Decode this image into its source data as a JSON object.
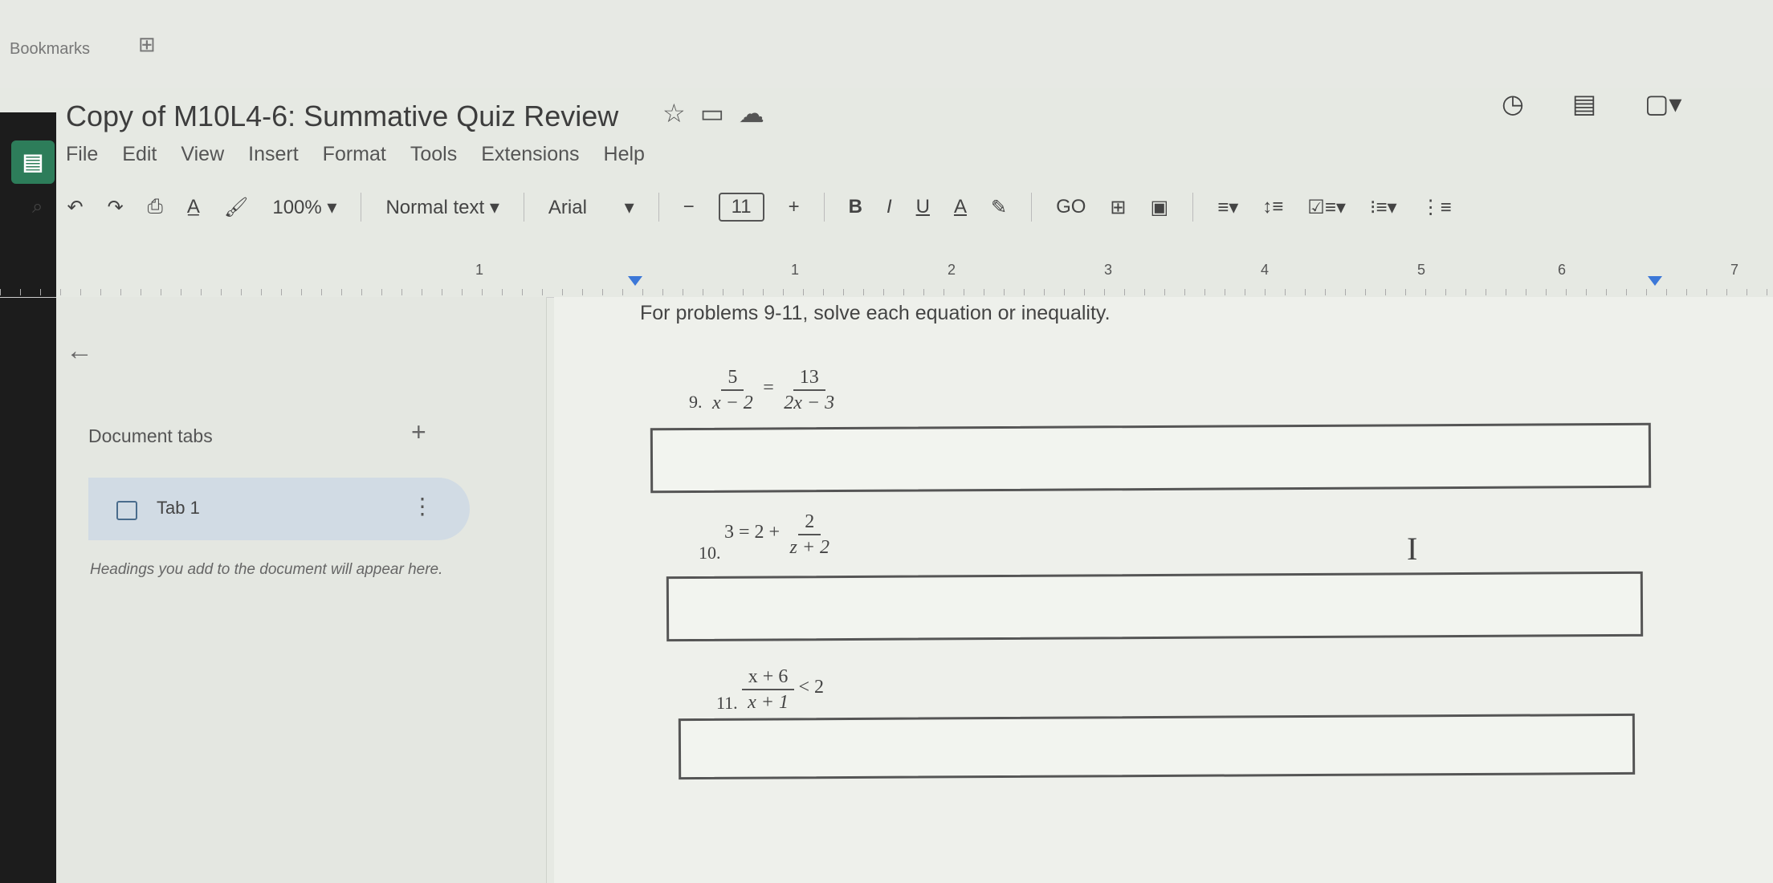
{
  "bookmarks": {
    "label": "Bookmarks"
  },
  "document": {
    "title": "Copy of M10L4-6: Summative Quiz Review"
  },
  "menu": [
    "File",
    "Edit",
    "View",
    "Insert",
    "Format",
    "Tools",
    "Extensions",
    "Help"
  ],
  "toolbar": {
    "zoom": "100%",
    "style": "Normal text",
    "font": "Arial",
    "font_size": "11",
    "bold": "B",
    "italic": "I",
    "underline": "U",
    "text_color": "A",
    "link": "GO"
  },
  "ruler": {
    "left_num": "1",
    "numbers": [
      "1",
      "2",
      "3",
      "4",
      "5",
      "6",
      "7"
    ]
  },
  "sidebar": {
    "title": "Document tabs",
    "add": "+",
    "tab_label": "Tab 1",
    "hint": "Headings you add to the document will appear here."
  },
  "content": {
    "instruction": "For problems 9-11, solve each equation or inequality.",
    "p9": {
      "num": "9.",
      "lhs_num": "5",
      "lhs_den": "x − 2",
      "op": "=",
      "rhs_num": "13",
      "rhs_den": "2x − 3"
    },
    "p10": {
      "num": "10.",
      "lead": "3 = 2 +",
      "frac_num": "2",
      "frac_den": "z + 2"
    },
    "p11": {
      "num": "11.",
      "frac_num": "x + 6",
      "frac_den": "x + 1",
      "tail": "< 2"
    }
  },
  "colors": {
    "accent": "#3c78d8",
    "brand": "#2d7d5a"
  }
}
